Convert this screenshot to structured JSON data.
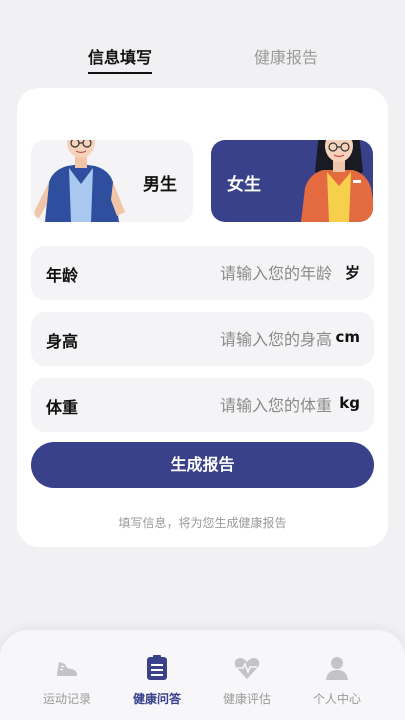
{
  "tabs": [
    {
      "label": "信息填写",
      "active": true
    },
    {
      "label": "健康报告",
      "active": false
    }
  ],
  "gender": {
    "male_label": "男生",
    "female_label": "女生",
    "selected": "female"
  },
  "fields": {
    "age": {
      "label": "年龄",
      "placeholder": "请输入您的年龄",
      "unit": "岁",
      "value": ""
    },
    "height": {
      "label": "身高",
      "placeholder": "请输入您的身高",
      "unit": "cm",
      "value": ""
    },
    "weight": {
      "label": "体重",
      "placeholder": "请输入您的体重",
      "unit": "kg",
      "value": ""
    }
  },
  "submit_label": "生成报告",
  "hint": "填写信息，将为您生成健康报告",
  "bottom_nav": [
    {
      "label": "运动记录",
      "icon": "shoe-icon",
      "active": false
    },
    {
      "label": "健康问答",
      "icon": "document-list-icon",
      "active": true
    },
    {
      "label": "健康评估",
      "icon": "heartbeat-icon",
      "active": false
    },
    {
      "label": "个人中心",
      "icon": "person-icon",
      "active": false
    }
  ],
  "colors": {
    "accent": "#38418a",
    "background": "#f1f1f3",
    "inactive": "#9a9a9a"
  }
}
